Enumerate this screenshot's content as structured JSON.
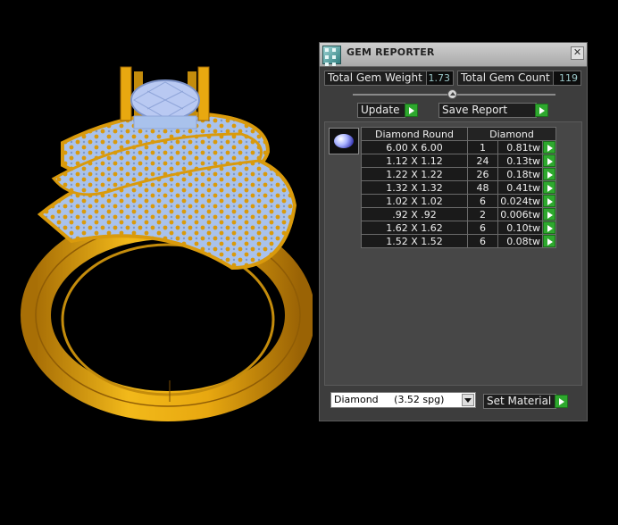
{
  "panel": {
    "title": "GEM REPORTER",
    "close_glyph": "✕",
    "total_weight_label": "Total Gem Weight",
    "total_weight_value": "1.73",
    "total_count_label": "Total Gem Count",
    "total_count_value": "119",
    "update_label": "Update",
    "save_report_label": "Save Report",
    "table_headers": {
      "type": "Diamond Round",
      "material": "Diamond"
    },
    "rows": [
      {
        "size": "6.00 X 6.00",
        "count": "1",
        "weight": "0.81tw"
      },
      {
        "size": "1.12 X 1.12",
        "count": "24",
        "weight": "0.13tw"
      },
      {
        "size": "1.22 X 1.22",
        "count": "26",
        "weight": "0.18tw"
      },
      {
        "size": "1.32 X 1.32",
        "count": "48",
        "weight": "0.41tw"
      },
      {
        "size": "1.02 X 1.02",
        "count": "6",
        "weight": "0.024tw"
      },
      {
        "size": ".92 X .92",
        "count": "2",
        "weight": "0.006tw"
      },
      {
        "size": "1.62 X 1.62",
        "count": "6",
        "weight": "0.10tw"
      },
      {
        "size": "1.52 X 1.52",
        "count": "6",
        "weight": "0.08tw"
      }
    ],
    "material_select": "Diamond     (3.52 spg)",
    "set_material_label": "Set Material"
  },
  "colors": {
    "metal": "#e1a212",
    "gem": "#a9c2ec",
    "panel_bg": "#3d3d3d",
    "value_text": "#9bc7c9",
    "button_green": "#2ea82e"
  }
}
